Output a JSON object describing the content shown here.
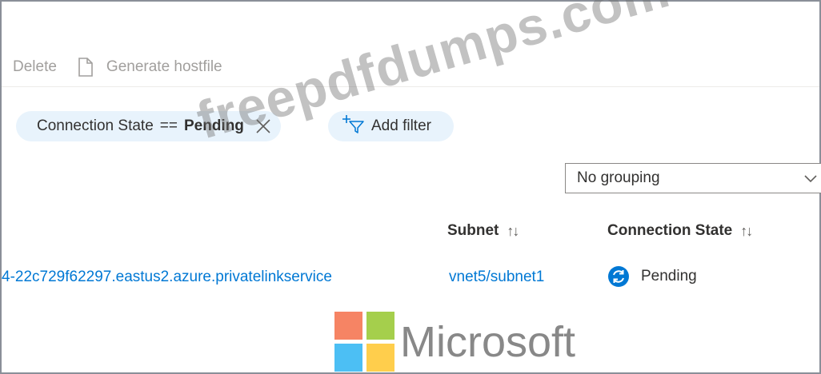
{
  "toolbar": {
    "delete_label": "Delete",
    "generate_label": "Generate hostfile"
  },
  "filters": {
    "active_filter": {
      "field": "Connection State",
      "operator": "==",
      "value": "Pending"
    },
    "add_filter_label": "Add filter"
  },
  "grouping": {
    "selected": "No grouping"
  },
  "table": {
    "columns": [
      {
        "label": "Subnet",
        "sort": "↑↓"
      },
      {
        "label": "Connection State",
        "sort": "↑↓"
      }
    ],
    "rows": [
      {
        "alias": "4-22c729f62297.eastus2.azure.privatelinkservice",
        "subnet": "vnet5/subnet1",
        "connection_state": "Pending",
        "state_icon": "sync-icon"
      }
    ]
  },
  "watermark": {
    "text": "freepdfdumps.com",
    "brand": "Microsoft",
    "colors": [
      "#f25022",
      "#7fba00",
      "#00a4ef",
      "#ffb900"
    ]
  },
  "colors": {
    "accent": "#0078d4",
    "pill_bg": "#e8f3fc",
    "disabled_text": "#a19f9d"
  }
}
